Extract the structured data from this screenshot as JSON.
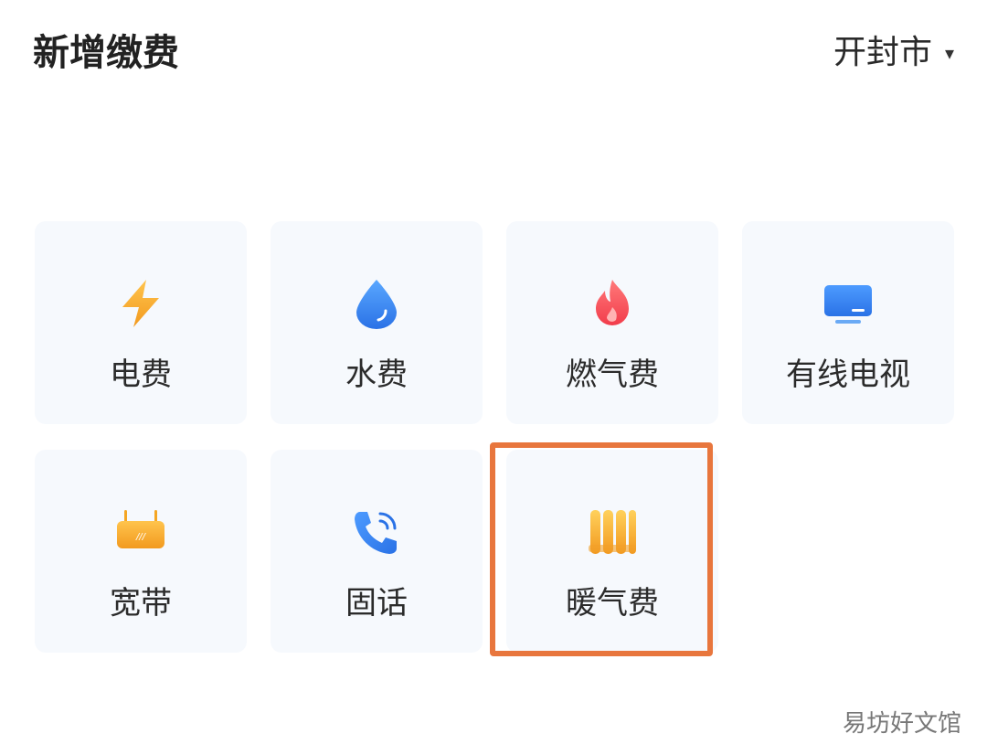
{
  "header": {
    "title": "新增缴费",
    "city": "开封市",
    "city_caret": "▾"
  },
  "tiles": [
    {
      "label": "电费",
      "icon": "lightning-icon"
    },
    {
      "label": "水费",
      "icon": "water-drop-icon"
    },
    {
      "label": "燃气费",
      "icon": "flame-icon"
    },
    {
      "label": "有线电视",
      "icon": "tv-icon"
    },
    {
      "label": "宽带",
      "icon": "router-icon"
    },
    {
      "label": "固话",
      "icon": "phone-icon"
    },
    {
      "label": "暖气费",
      "icon": "radiator-icon"
    }
  ],
  "watermark": "易坊好文馆",
  "colors": {
    "tile_bg": "#f6f9fd",
    "highlight_border": "#e8763d",
    "electricity": "#f5a623",
    "water": "#3b8bf0",
    "gas": "#f4505a",
    "tv": "#2f83f0",
    "broadband": "#f5a623",
    "phone": "#2f83f0",
    "heating": "#f5a623"
  }
}
